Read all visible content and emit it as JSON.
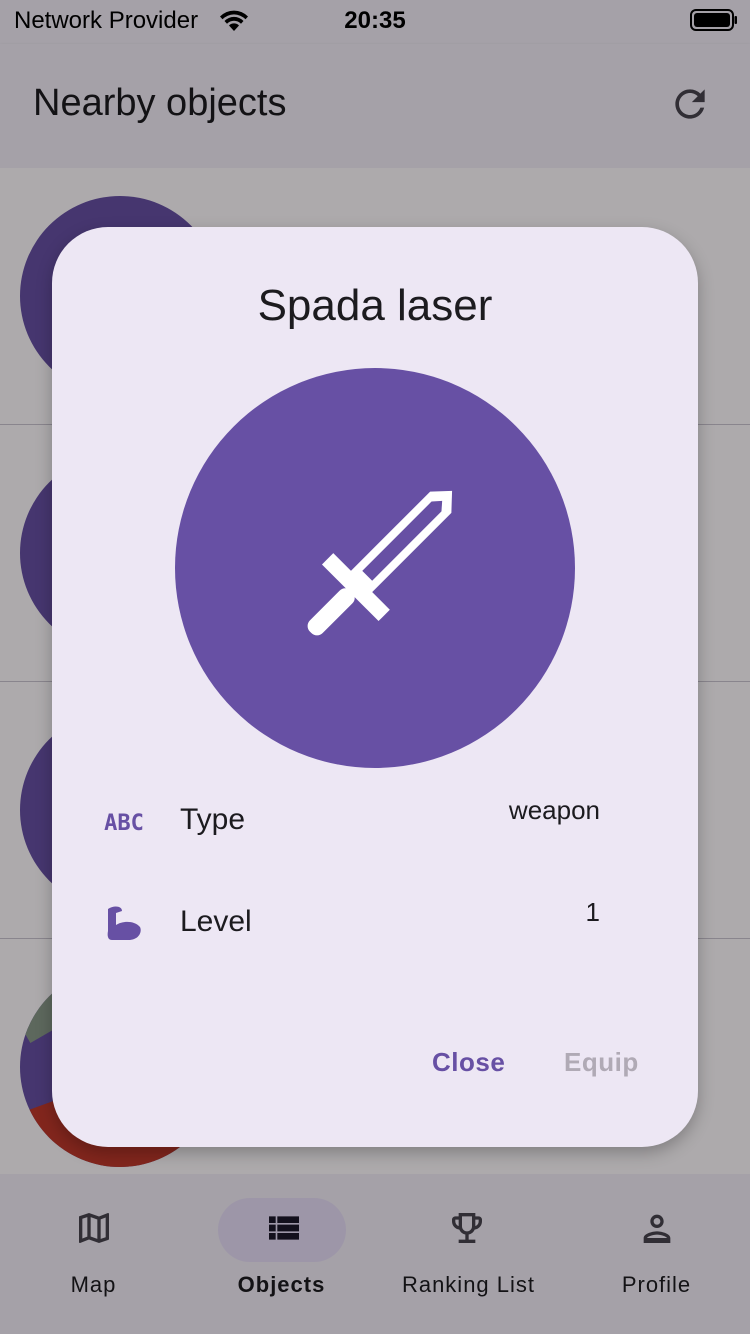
{
  "status_bar": {
    "carrier": "Network Provider",
    "time": "20:35"
  },
  "app_bar": {
    "title": "Nearby objects",
    "refresh_icon": "refresh-icon"
  },
  "dialog": {
    "title": "Spada laser",
    "image_icon": "sword-icon",
    "rows": [
      {
        "icon": "abc-icon",
        "label": "Type",
        "value": "weapon"
      },
      {
        "icon": "bicep-icon",
        "label": "Level",
        "value": "1"
      }
    ],
    "buttons": {
      "close": "Close",
      "equip": "Equip"
    }
  },
  "bottom_nav": {
    "items": [
      {
        "icon": "map-icon",
        "label": "Map",
        "active": false
      },
      {
        "icon": "list-icon",
        "label": "Objects",
        "active": true
      },
      {
        "icon": "trophy-icon",
        "label": "Ranking List",
        "active": false
      },
      {
        "icon": "person-icon",
        "label": "Profile",
        "active": false
      }
    ]
  },
  "colors": {
    "primary": "#6750a4",
    "surface": "#ede7f4",
    "disabled": "#b0aab5"
  }
}
